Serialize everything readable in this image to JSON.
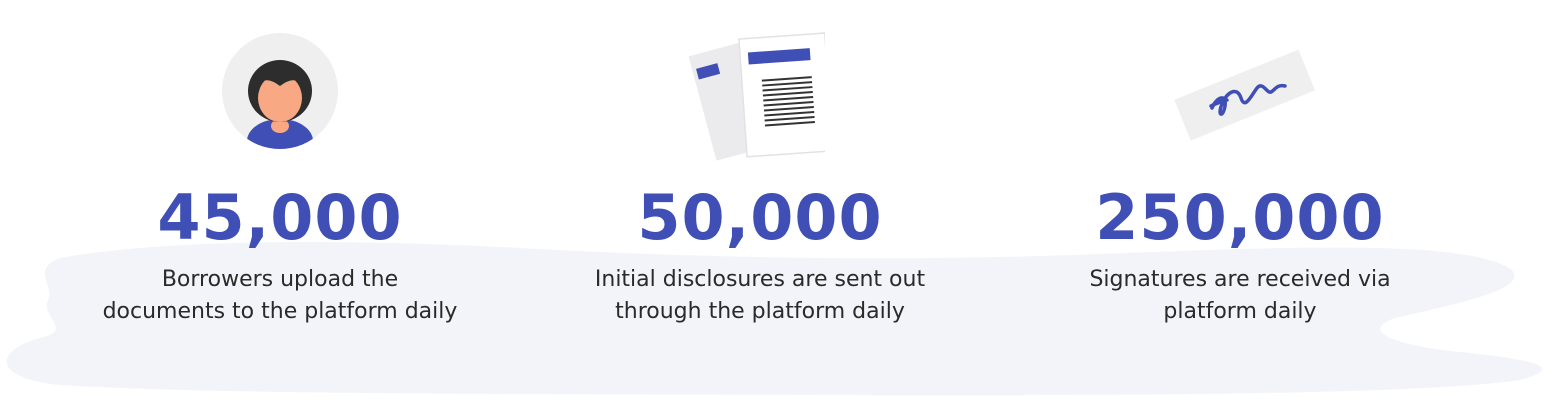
{
  "colors": {
    "accent": "#3f4fb5",
    "blob": "#f3f4f9",
    "icon_bg": "#efefef",
    "text": "#2a2a2a"
  },
  "stats": [
    {
      "icon": "person-avatar-icon",
      "value": "45,000",
      "line1": "Borrowers upload the",
      "line2": "documents to the platform daily"
    },
    {
      "icon": "documents-icon",
      "value": "50,000",
      "line1": "Initial disclosures are sent out",
      "line2": "through the platform daily"
    },
    {
      "icon": "signature-icon",
      "value": "250,000",
      "line1": "Signatures are received via",
      "line2": "platform daily"
    }
  ]
}
